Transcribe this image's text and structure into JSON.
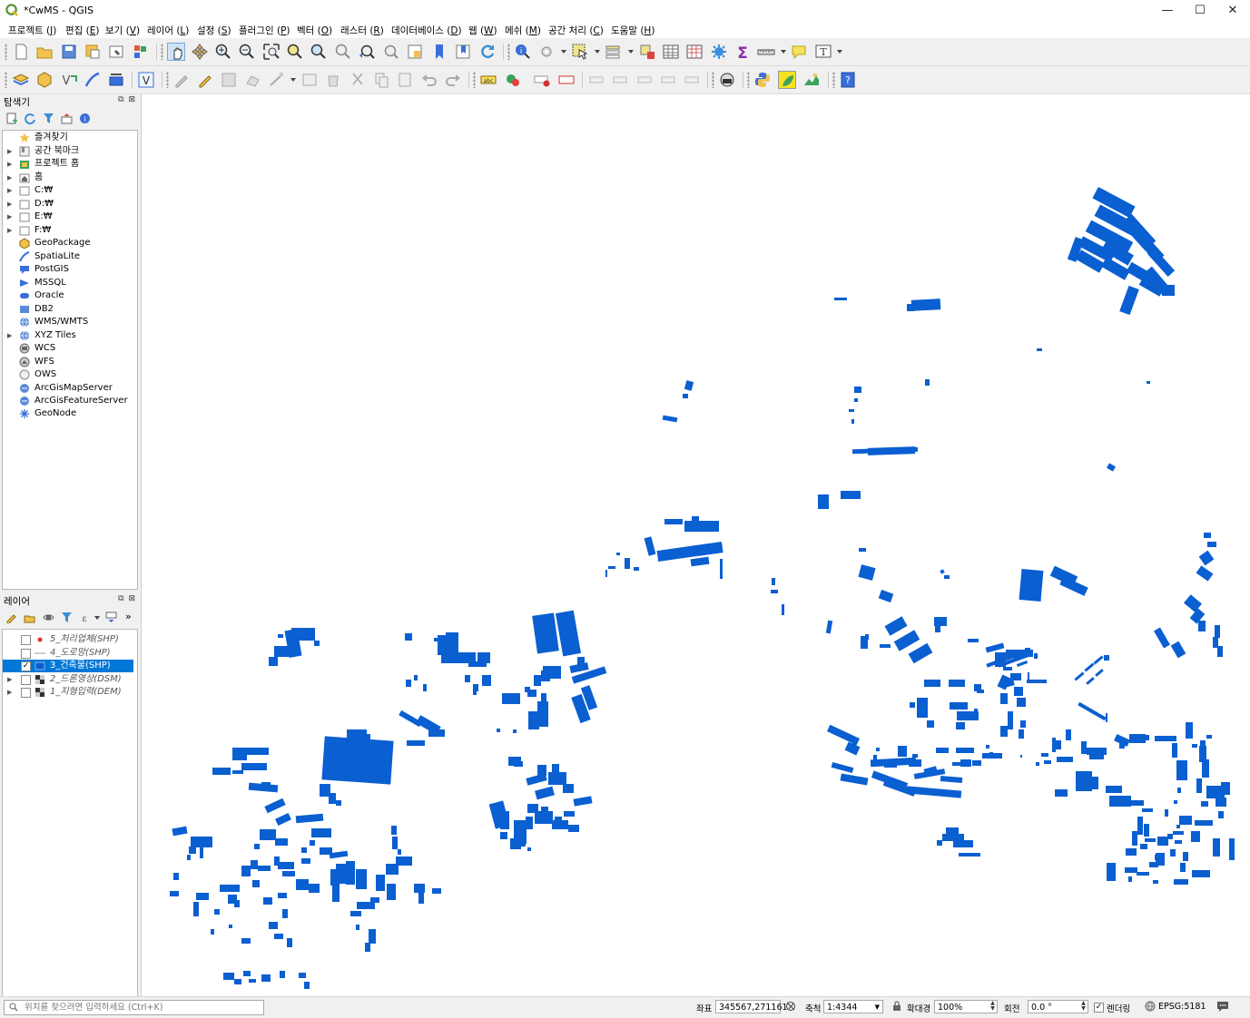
{
  "window": {
    "title": "*CwMS - QGIS",
    "controls": {
      "minimize": "—",
      "maximize": "☐",
      "close": "✕"
    }
  },
  "menubar": {
    "items": [
      {
        "label": "프로젝트",
        "key": "J"
      },
      {
        "label": "편집",
        "key": "E"
      },
      {
        "label": "보기",
        "key": "V"
      },
      {
        "label": "레이어",
        "key": "L"
      },
      {
        "label": "설정",
        "key": "S"
      },
      {
        "label": "플러그인",
        "key": "P"
      },
      {
        "label": "벡터",
        "key": "O"
      },
      {
        "label": "래스터",
        "key": "R"
      },
      {
        "label": "데이터베이스",
        "key": "D"
      },
      {
        "label": "웹",
        "key": "W"
      },
      {
        "label": "메쉬",
        "key": "M"
      },
      {
        "label": "공간 처리",
        "key": "C"
      },
      {
        "label": "도움말",
        "key": "H"
      }
    ]
  },
  "browser_panel": {
    "title": "탐색기",
    "items": [
      {
        "label": "즐겨찾기",
        "icon": "star-icon",
        "expandable": false
      },
      {
        "label": "공간 북마크",
        "icon": "bookmark-icon",
        "expandable": true
      },
      {
        "label": "프로젝트 홈",
        "icon": "project-home-icon",
        "expandable": true
      },
      {
        "label": "홈",
        "icon": "home-folder-icon",
        "expandable": true
      },
      {
        "label": "C:₩",
        "icon": "drive-icon",
        "expandable": true
      },
      {
        "label": "D:₩",
        "icon": "drive-icon",
        "expandable": true
      },
      {
        "label": "E:₩",
        "icon": "drive-icon",
        "expandable": true
      },
      {
        "label": "F:₩",
        "icon": "drive-icon",
        "expandable": true
      },
      {
        "label": "GeoPackage",
        "icon": "geopackage-icon",
        "expandable": false
      },
      {
        "label": "SpatiaLite",
        "icon": "spatialite-icon",
        "expandable": false
      },
      {
        "label": "PostGIS",
        "icon": "postgis-icon",
        "expandable": false
      },
      {
        "label": "MSSQL",
        "icon": "mssql-icon",
        "expandable": false
      },
      {
        "label": "Oracle",
        "icon": "oracle-icon",
        "expandable": false
      },
      {
        "label": "DB2",
        "icon": "db2-icon",
        "expandable": false
      },
      {
        "label": "WMS/WMTS",
        "icon": "globe-icon",
        "expandable": false
      },
      {
        "label": "XYZ Tiles",
        "icon": "globe-icon",
        "expandable": true
      },
      {
        "label": "WCS",
        "icon": "wcs-icon",
        "expandable": false
      },
      {
        "label": "WFS",
        "icon": "wfs-icon",
        "expandable": false
      },
      {
        "label": "OWS",
        "icon": "ows-icon",
        "expandable": false
      },
      {
        "label": "ArcGisMapServer",
        "icon": "arcgis-icon",
        "expandable": false
      },
      {
        "label": "ArcGisFeatureServer",
        "icon": "arcgis-icon",
        "expandable": false
      },
      {
        "label": "GeoNode",
        "icon": "geonode-icon",
        "expandable": false
      }
    ]
  },
  "layers_panel": {
    "title": "레이어",
    "layers": [
      {
        "name": "5_처리업체(SHP)",
        "checked": false,
        "selected": false,
        "symbol": "point",
        "expandable": false
      },
      {
        "name": "4_도로망(SHP)",
        "checked": false,
        "selected": false,
        "symbol": "line",
        "expandable": false
      },
      {
        "name": "3_건축물(SHP)",
        "checked": true,
        "selected": true,
        "symbol": "polygon",
        "expandable": false
      },
      {
        "name": "2_드론영상(DSM)",
        "checked": false,
        "selected": false,
        "symbol": "raster",
        "expandable": true
      },
      {
        "name": "1_지형입력(DEM)",
        "checked": false,
        "selected": false,
        "symbol": "raster",
        "expandable": true
      }
    ]
  },
  "map": {
    "fill_color": "#0a5fd1",
    "background": "#ffffff"
  },
  "statusbar": {
    "locator_placeholder": "위치를 찾으려면 입력하세요 (Ctrl+K)",
    "coord_label": "좌표",
    "coord_value": "345567,271161",
    "scale_label": "축척",
    "scale_value": "1:4344",
    "magnifier_label": "확대경",
    "magnifier_value": "100%",
    "rotation_label": "회전",
    "rotation_value": "0.0 °",
    "render_label": "렌더링",
    "render_checked": true,
    "crs_value": "EPSG:5181"
  }
}
